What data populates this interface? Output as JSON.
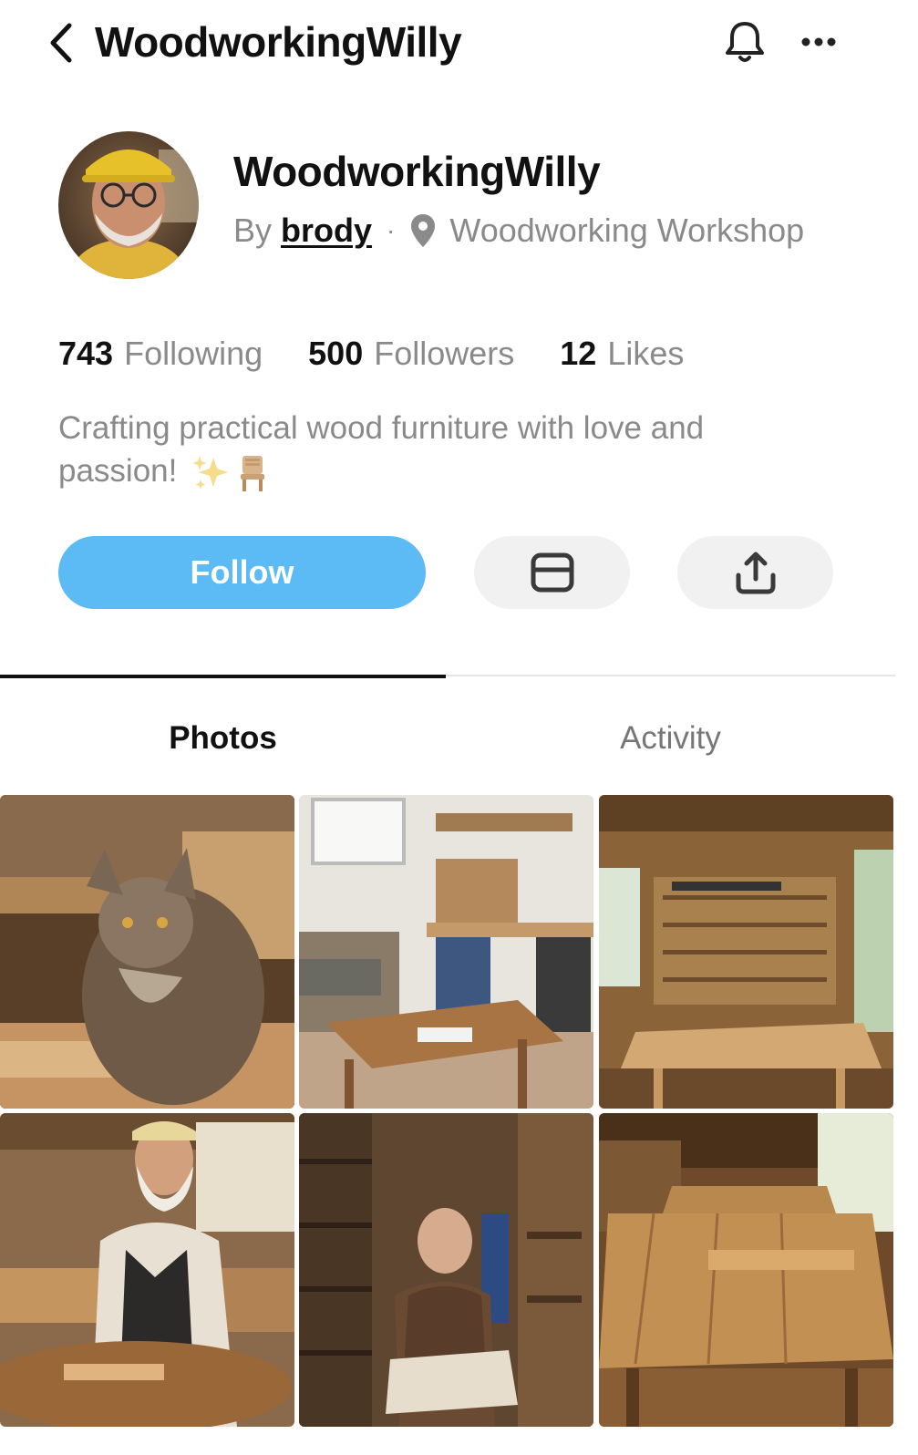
{
  "header": {
    "back_icon": "chevron-left-icon",
    "title": "WoodworkingWilly",
    "bell_icon": "bell-icon",
    "more_icon": "more-horizontal-icon"
  },
  "profile": {
    "name": "WoodworkingWilly",
    "by_label": "By",
    "author": "brody",
    "separator": "·",
    "location_icon": "map-pin-icon",
    "location": "Woodworking Workshop",
    "avatar_alt": "avatar"
  },
  "stats": {
    "following": {
      "count": "743",
      "label": "Following"
    },
    "followers": {
      "count": "500",
      "label": "Followers"
    },
    "likes": {
      "count": "12",
      "label": "Likes"
    }
  },
  "bio": {
    "text": "Crafting practical wood furniture with love and passion!",
    "emojis": [
      "sparkles-icon",
      "chair-icon"
    ]
  },
  "actions": {
    "follow_label": "Follow",
    "message_icon": "mail-icon",
    "share_icon": "share-icon"
  },
  "tabs": [
    {
      "label": "Photos",
      "active": true
    },
    {
      "label": "Activity",
      "active": false
    }
  ],
  "colors": {
    "accent": "#5cbaf5",
    "muted_text": "#8a8a8a",
    "button_gray": "#f1f1f1"
  }
}
